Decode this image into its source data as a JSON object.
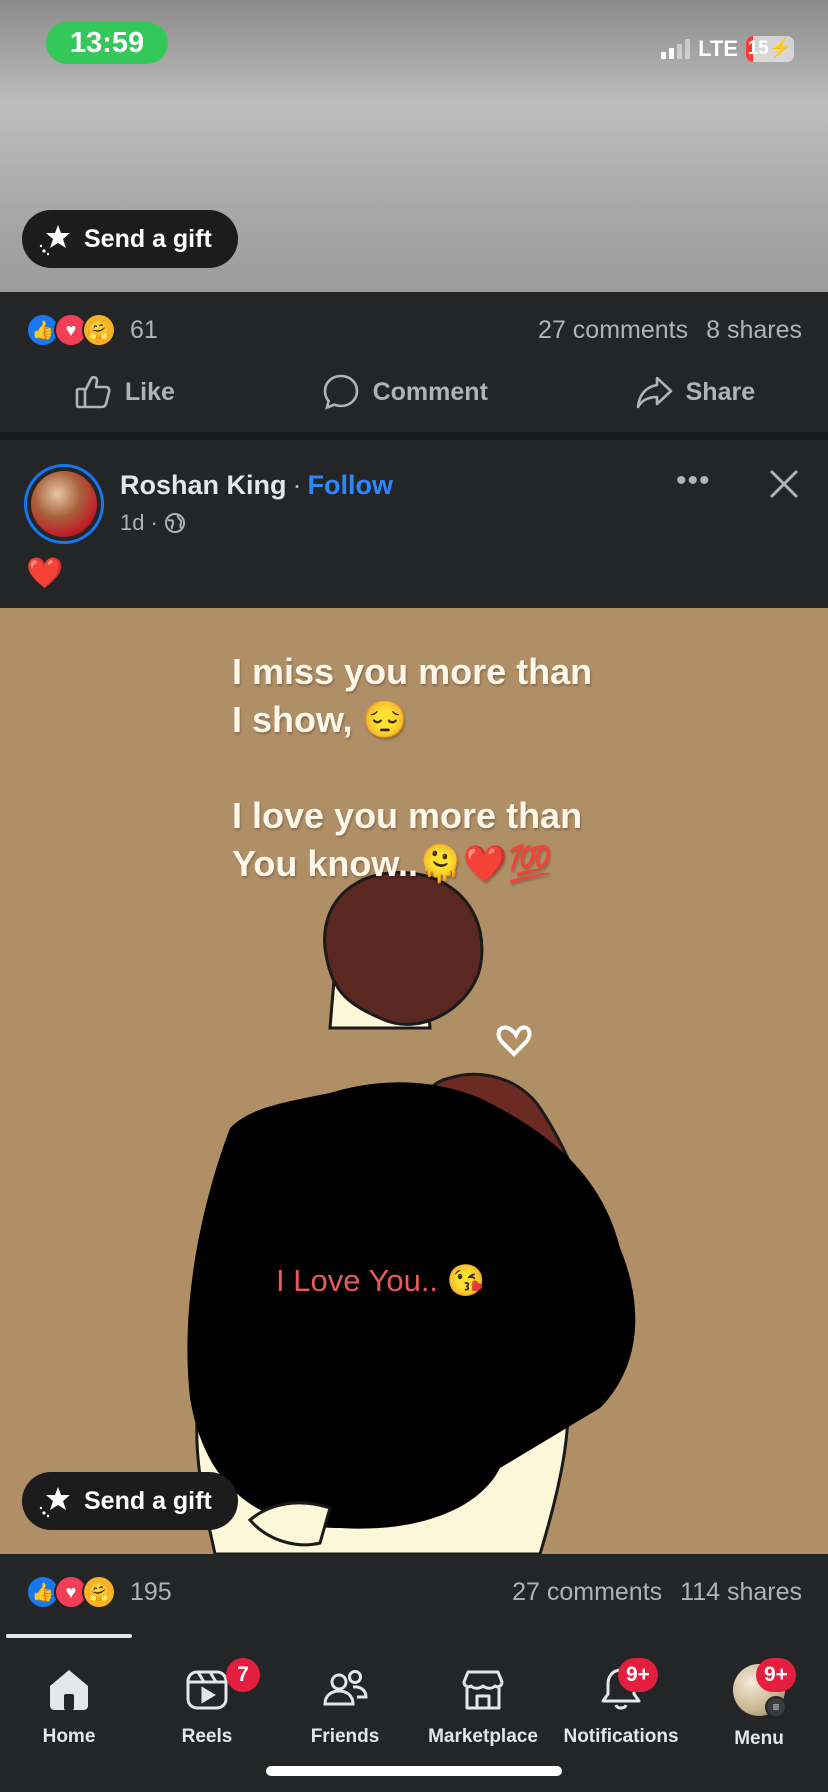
{
  "status_bar": {
    "time": "13:59",
    "network": "LTE",
    "battery": "15"
  },
  "previous_post": {
    "gift_label": "Send a gift",
    "reaction_count": "61",
    "comments": "27 comments",
    "shares": "8 shares"
  },
  "actions": {
    "like": "Like",
    "comment": "Comment",
    "share": "Share"
  },
  "post": {
    "author": "Roshan King",
    "separator": "·",
    "follow": "Follow",
    "time": "1d",
    "meta_separator": "·",
    "caption": "❤️",
    "image_text": {
      "line1": "I miss you more than",
      "line2": "I show, 😔",
      "line3": "I love you more than",
      "line4": "You know..🫠❤️💯",
      "inner": "I Love You.. 😘"
    },
    "gift_label": "Send a gift",
    "reaction_count": "195",
    "comments": "27 comments",
    "shares": "114 shares"
  },
  "nav": {
    "items": [
      {
        "label": "Home",
        "icon": "home-icon",
        "active": true
      },
      {
        "label": "Reels",
        "icon": "reels-icon",
        "badge": "7"
      },
      {
        "label": "Friends",
        "icon": "friends-icon"
      },
      {
        "label": "Marketplace",
        "icon": "marketplace-icon"
      },
      {
        "label": "Notifications",
        "icon": "bell-icon",
        "badge": "9+"
      },
      {
        "label": "Menu",
        "icon": "profile-avatar",
        "badge": "9+"
      }
    ]
  },
  "colors": {
    "background": "#242526",
    "accent": "#2d88ff",
    "badge": "#e41e3f",
    "image_bg": "#b08f66"
  }
}
